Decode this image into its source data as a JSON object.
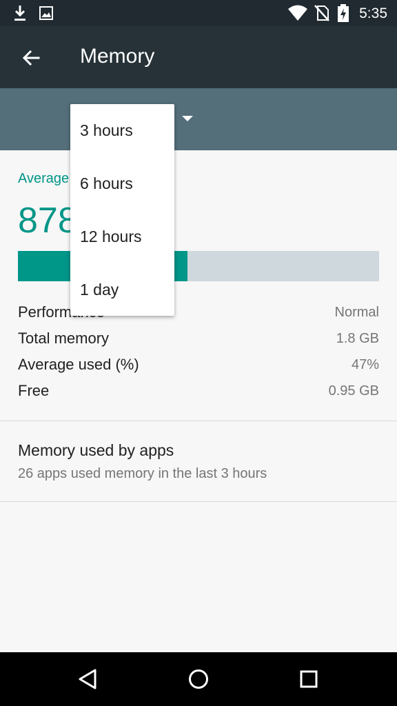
{
  "status_bar": {
    "time": "5:35",
    "left_icons": [
      "download-icon",
      "image-icon"
    ],
    "right_icons": [
      "wifi-icon",
      "no-sim-icon",
      "battery-charging-icon"
    ]
  },
  "app_bar": {
    "title": "Memory",
    "back_icon": "arrow-back-icon"
  },
  "spinner": {
    "options": [
      "3 hours",
      "6 hours",
      "12 hours",
      "1 day"
    ]
  },
  "summary": {
    "average_label_partial": "Average",
    "average_value_partial": "878",
    "usage_fraction": 0.47
  },
  "stats": [
    {
      "label": "Performance",
      "value": "Normal"
    },
    {
      "label": "Total memory",
      "value": "1.8 GB"
    },
    {
      "label": "Average used (%)",
      "value": "47%"
    },
    {
      "label": "Free",
      "value": "0.95 GB"
    }
  ],
  "apps": {
    "title": "Memory used by apps",
    "subtitle": "26 apps used memory in the last 3 hours"
  },
  "nav_bar": {
    "buttons": [
      "back-triangle-icon",
      "home-circle-icon",
      "recents-square-icon"
    ]
  },
  "colors": {
    "accent": "#009688",
    "status_bar": "#202a30",
    "app_bar": "#263238",
    "spinner_band": "#546e7a",
    "bar_track": "#cfd8dc"
  }
}
